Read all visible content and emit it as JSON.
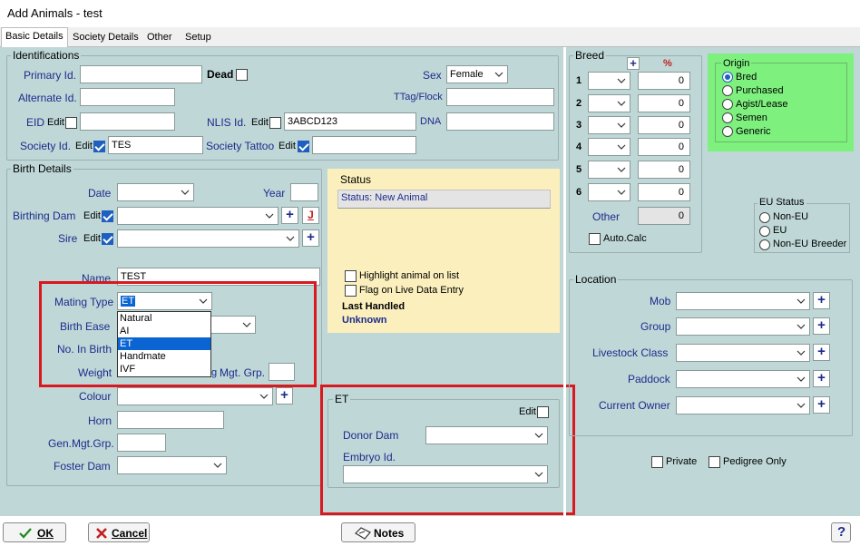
{
  "window": {
    "title": "Add Animals - test"
  },
  "tabs": [
    "Basic Details",
    "Society Details",
    "Other",
    "Setup"
  ],
  "identifications": {
    "title": "Identifications",
    "primary_id_label": "Primary Id.",
    "primary_id_value": "",
    "dead_label": "Dead",
    "alternate_id_label": "Alternate Id.",
    "eid_label": "EID",
    "nlis_label": "NLIS Id.",
    "nlis_value": "3ABCD123",
    "society_id_label": "Society Id.",
    "society_id_value": "TES",
    "society_tattoo_label": "Society Tattoo",
    "sex_label": "Sex",
    "sex_value": "Female",
    "ttag_label": "TTag/Flock",
    "dna_label": "DNA",
    "edit_label": "Edit"
  },
  "birth": {
    "title": "Birth Details",
    "date_label": "Date",
    "year_label": "Year",
    "birthing_dam_label": "Birthing Dam",
    "sire_label": "Sire",
    "name_label": "Name",
    "name_value": "TEST",
    "mating_type_label": "Mating Type",
    "mating_type_value": "ET",
    "mating_options": [
      "Natural",
      "AI",
      "ET",
      "Handmate",
      "IVF"
    ],
    "birth_ease_label": "Birth Ease",
    "no_in_birth_label": "No. In Birth",
    "weight_label": "Weight",
    "weight_unit_partial": "g",
    "mgt_grp_label": "Mgt. Grp.",
    "colour_label": "Colour",
    "horn_label": "Horn",
    "gen_mgt_grp_label": "Gen.Mgt.Grp.",
    "foster_dam_label": "Foster Dam",
    "j_label": "J"
  },
  "status": {
    "title": "Status",
    "status_text": "Status: New Animal",
    "highlight_label": "Highlight animal on list",
    "flag_label": "Flag on Live Data Entry",
    "last_handled_label": "Last Handled",
    "last_handled_value": "Unknown"
  },
  "et": {
    "title": "ET",
    "edit_label": "Edit",
    "donor_dam_label": "Donor Dam",
    "embryo_id_label": "Embryo Id."
  },
  "breed": {
    "title": "Breed",
    "plus": "+",
    "percent_header": "%",
    "rows": [
      {
        "num": "1",
        "value": "0"
      },
      {
        "num": "2",
        "value": "0"
      },
      {
        "num": "3",
        "value": "0"
      },
      {
        "num": "4",
        "value": "0"
      },
      {
        "num": "5",
        "value": "0"
      },
      {
        "num": "6",
        "value": "0"
      }
    ],
    "other_label": "Other",
    "other_value": "0",
    "auto_calc_label": "Auto.Calc"
  },
  "origin": {
    "title": "Origin",
    "options": [
      "Bred",
      "Purchased",
      "Agist/Lease",
      "Semen",
      "Generic"
    ],
    "selected": "Bred"
  },
  "eu_status": {
    "title": "EU Status",
    "options": [
      "Non-EU",
      "EU",
      "Non-EU Breeder"
    ]
  },
  "location": {
    "title": "Location",
    "fields": [
      "Mob",
      "Group",
      "Livestock Class",
      "Paddock",
      "Current Owner"
    ]
  },
  "flags": {
    "private_label": "Private",
    "pedigree_only_label": "Pedigree Only"
  },
  "footer": {
    "ok_label": "OK",
    "cancel_label": "Cancel",
    "notes_label": "Notes",
    "help_label": "?"
  },
  "colors": {
    "panel": "#bfd7d7",
    "highlight": "#d9181f",
    "label": "#1d2c8c",
    "status_bg": "#fbefbd",
    "origin_bg": "#7ef07e"
  }
}
